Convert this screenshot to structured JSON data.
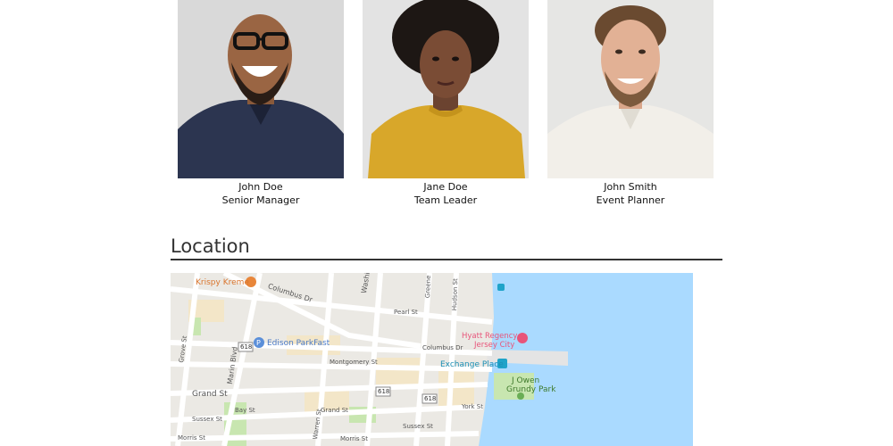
{
  "team": [
    {
      "name": "John Doe",
      "role": "Senior Manager"
    },
    {
      "name": "Jane Doe",
      "role": "Team Leader"
    },
    {
      "name": "John Smith",
      "role": "Event Planner"
    }
  ],
  "location": {
    "title": "Location",
    "map_labels": {
      "krispy_kreme": "Krispy Kreme",
      "columbus_dr": "Columbus Dr",
      "washington_st": "Washington St",
      "greene_st": "Greene St",
      "hudson_st": "Hudson St",
      "pearl_st": "Pearl St",
      "edison_parkfast": "Edison ParkFast",
      "marin_blvd": "Marin Blvd",
      "grove_st": "Grove St",
      "montgomery_st": "Montgomery St",
      "columbus_dr_2": "Columbus Dr",
      "hyatt": "Hyatt Regency",
      "hyatt_2": "Jersey City",
      "exchange_place": "Exchange Place",
      "j_owen": "J Owen",
      "grundy_park": "Grundy Park",
      "grand_st": "Grand St",
      "grand_st_2": "Grand St",
      "sussex_st": "Sussex St",
      "sussex_st_2": "Sussex St",
      "york_st": "York St",
      "morris_st": "Morris St",
      "warren_st": "Warren St",
      "route_618a": "618",
      "route_618b": "618",
      "route_618c": "618",
      "bay_st": "Bay St",
      "morris_st_2": "Morris St"
    }
  },
  "colors": {
    "water": "#aadaff",
    "road": "#ffffff",
    "block": "#ebe9e4",
    "park": "#c8e6b0",
    "poi_orange": "#e8863a",
    "poi_blue": "#5b8fd9",
    "poi_pink": "#e8547a",
    "transit": "#1fa3c9"
  }
}
